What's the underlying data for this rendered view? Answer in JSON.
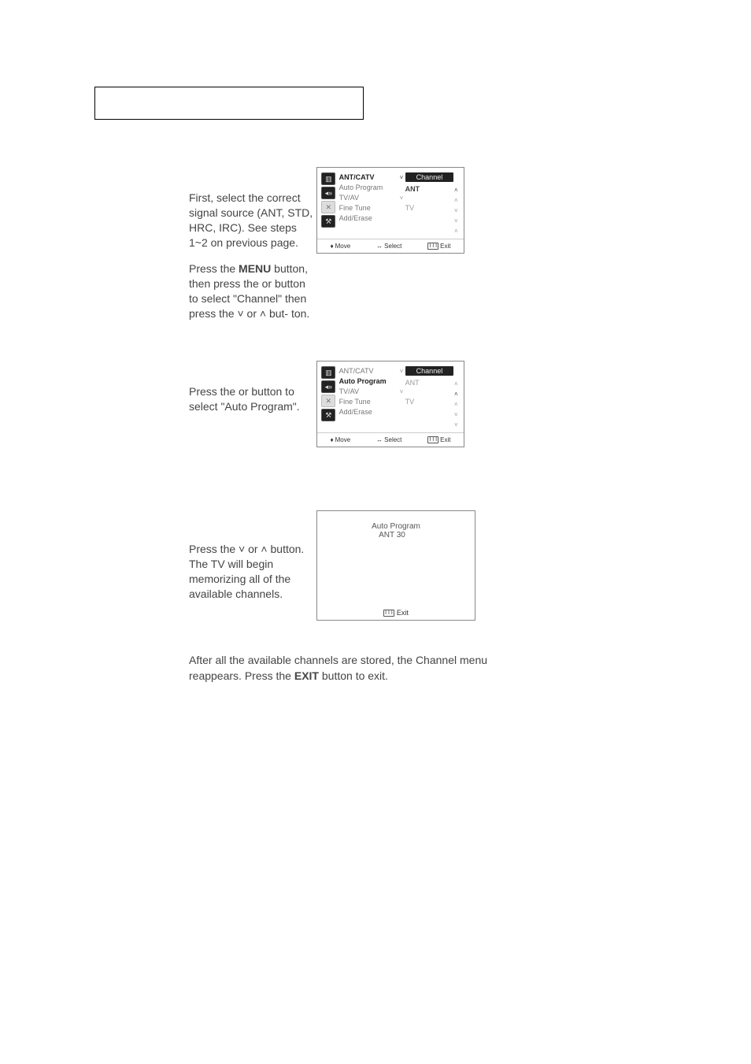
{
  "step1": {
    "text_a": "First, select the correct signal source (ANT, STD, HRC, IRC). See steps 1~2 on previous page.",
    "text_b1": "Press the ",
    "menu_bold": "MENU",
    "text_b2": " button, then press the    or    button to select \"Channel\" then press the  ˅  or  ˄  but- ton."
  },
  "step2": {
    "text": "Press the    or    button to select \"Auto Program\"."
  },
  "step3": {
    "text": "Press the  ˅  or  ˄  button. The TV will begin memorizing all of the available channels."
  },
  "step4": {
    "text_a": "After all the available channels are stored, the Channel menu reappears. Press the ",
    "exit_bold": "EXIT",
    "text_b": " button to exit."
  },
  "osd": {
    "title": "Channel",
    "items": [
      "ANT/CATV",
      "Auto Program",
      "TV/AV",
      "Fine Tune",
      "Add/Erase"
    ],
    "vals": [
      "ANT",
      "",
      "TV",
      "",
      ""
    ],
    "footer_move": "Move",
    "footer_select": "Select",
    "footer_exit": "Exit"
  },
  "osd2": {
    "title": "Auto Program",
    "line2": "ANT    30",
    "exit": "Exit"
  }
}
